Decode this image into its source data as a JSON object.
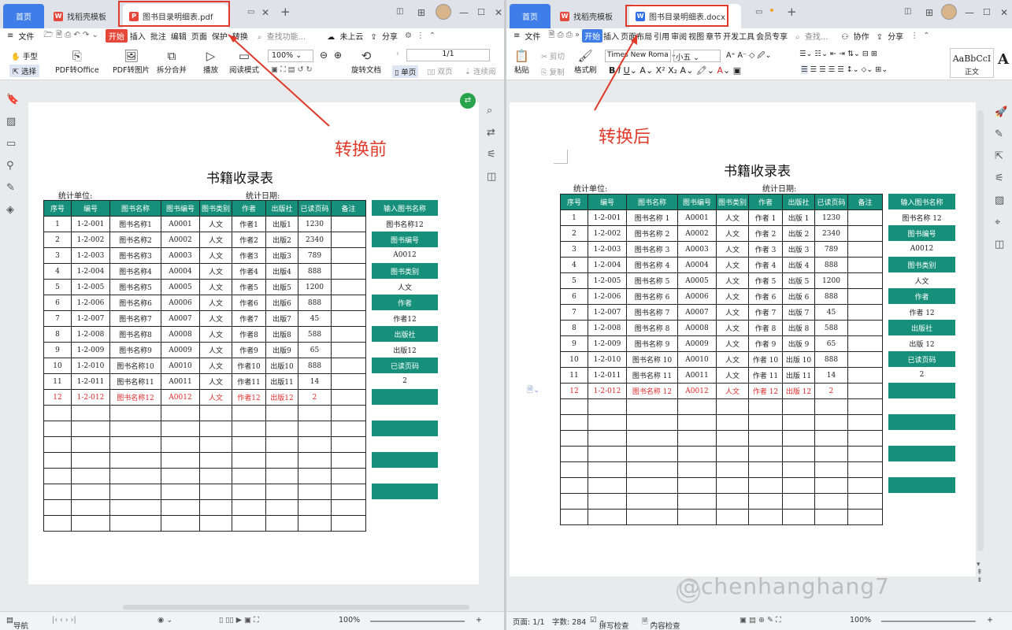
{
  "left": {
    "tabs": {
      "home": "首页",
      "template": "找稻壳模板",
      "active": "图书目录明细表.pdf"
    },
    "menu": [
      "文件",
      "开始",
      "插入",
      "批注",
      "编辑",
      "页面",
      "保护",
      "转换"
    ],
    "search": "查找功能...",
    "ribbon": {
      "hand": "手型",
      "select": "选择",
      "pdf_office": "PDF转Office",
      "pdf_image": "PDF转图片",
      "split": "拆分合并",
      "play": "播放",
      "read": "阅读模式",
      "zoom": "100%",
      "rotate": "旋转文档",
      "page": "1/1",
      "single": "单页",
      "double": "双页",
      "continuous": "连续阅"
    },
    "annotation": "转换前",
    "status": {
      "nav": "导航",
      "zoom": "100%"
    }
  },
  "right": {
    "tabs": {
      "home": "首页",
      "template": "找稻壳模板",
      "active": "图书目录明细表.docx"
    },
    "menu": [
      "文件",
      "开始",
      "插入",
      "页面布局",
      "引用",
      "审阅",
      "视图",
      "章节",
      "开发工具",
      "会员专享"
    ],
    "search": "查找...",
    "collab": "协作",
    "share": "分享",
    "ribbon": {
      "paste": "粘贴",
      "cut": "剪切",
      "copy": "复制",
      "format_painter": "格式刷",
      "font": "Times New Roma",
      "size": "小五",
      "style_sample": "AaBbCcI",
      "style_name": "正文"
    },
    "annotation": "转换后",
    "status": {
      "page": "页面: 1/1",
      "words": "字数: 284",
      "spell": "拼写检查",
      "content": "内容检查",
      "zoom": "100%"
    }
  },
  "upload": "未上云",
  "share": "分享",
  "watermark": "@chenhanghang7",
  "doc": {
    "title": "书籍收录表",
    "unit_label": "统计单位:",
    "date_label": "统计日期:",
    "headers": [
      "序号",
      "编号",
      "图书名称",
      "图书编号",
      "图书类别",
      "作者",
      "出版社",
      "已读页码",
      "备注"
    ],
    "rows_pdf": [
      [
        "1",
        "1-2-001",
        "图书名称1",
        "A0001",
        "人文",
        "作者1",
        "出版1",
        "1230",
        ""
      ],
      [
        "2",
        "1-2-002",
        "图书名称2",
        "A0002",
        "人文",
        "作者2",
        "出版2",
        "2340",
        ""
      ],
      [
        "3",
        "1-2-003",
        "图书名称3",
        "A0003",
        "人文",
        "作者3",
        "出版3",
        "789",
        ""
      ],
      [
        "4",
        "1-2-004",
        "图书名称4",
        "A0004",
        "人文",
        "作者4",
        "出版4",
        "888",
        ""
      ],
      [
        "5",
        "1-2-005",
        "图书名称5",
        "A0005",
        "人文",
        "作者5",
        "出版5",
        "1200",
        ""
      ],
      [
        "6",
        "1-2-006",
        "图书名称6",
        "A0006",
        "人文",
        "作者6",
        "出版6",
        "888",
        ""
      ],
      [
        "7",
        "1-2-007",
        "图书名称7",
        "A0007",
        "人文",
        "作者7",
        "出版7",
        "45",
        ""
      ],
      [
        "8",
        "1-2-008",
        "图书名称8",
        "A0008",
        "人文",
        "作者8",
        "出版8",
        "588",
        ""
      ],
      [
        "9",
        "1-2-009",
        "图书名称9",
        "A0009",
        "人文",
        "作者9",
        "出版9",
        "65",
        ""
      ],
      [
        "10",
        "1-2-010",
        "图书名称10",
        "A0010",
        "人文",
        "作者10",
        "出版10",
        "888",
        ""
      ],
      [
        "11",
        "1-2-011",
        "图书名称11",
        "A0011",
        "人文",
        "作者11",
        "出版11",
        "14",
        ""
      ],
      [
        "12",
        "1-2-012",
        "图书名称12",
        "A0012",
        "人文",
        "作者12",
        "出版12",
        "2",
        ""
      ]
    ],
    "rows_docx": [
      [
        "1",
        "1-2-001",
        "图书名称 1",
        "A0001",
        "人文",
        "作者 1",
        "出版 1",
        "1230",
        ""
      ],
      [
        "2",
        "1-2-002",
        "图书名称 2",
        "A0002",
        "人文",
        "作者 2",
        "出版 2",
        "2340",
        ""
      ],
      [
        "3",
        "1-2-003",
        "图书名称 3",
        "A0003",
        "人文",
        "作者 3",
        "出版 3",
        "789",
        ""
      ],
      [
        "4",
        "1-2-004",
        "图书名称 4",
        "A0004",
        "人文",
        "作者 4",
        "出版 4",
        "888",
        ""
      ],
      [
        "5",
        "1-2-005",
        "图书名称 5",
        "A0005",
        "人文",
        "作者 5",
        "出版 5",
        "1200",
        ""
      ],
      [
        "6",
        "1-2-006",
        "图书名称 6",
        "A0006",
        "人文",
        "作者 6",
        "出版 6",
        "888",
        ""
      ],
      [
        "7",
        "1-2-007",
        "图书名称 7",
        "A0007",
        "人文",
        "作者 7",
        "出版 7",
        "45",
        ""
      ],
      [
        "8",
        "1-2-008",
        "图书名称 8",
        "A0008",
        "人文",
        "作者 8",
        "出版 8",
        "588",
        ""
      ],
      [
        "9",
        "1-2-009",
        "图书名称 9",
        "A0009",
        "人文",
        "作者 9",
        "出版 9",
        "65",
        ""
      ],
      [
        "10",
        "1-2-010",
        "图书名称 10",
        "A0010",
        "人文",
        "作者 10",
        "出版 10",
        "888",
        ""
      ],
      [
        "11",
        "1-2-011",
        "图书名称 11",
        "A0011",
        "人文",
        "作者 11",
        "出版 11",
        "14",
        ""
      ],
      [
        "12",
        "1-2-012",
        "图书名称 12",
        "A0012",
        "人文",
        "作者 12",
        "出版 12",
        "2",
        ""
      ]
    ],
    "panel_pdf": [
      "输入图书名称",
      "图书名称12",
      "图书编号",
      "A0012",
      "图书类别",
      "人文",
      "作者",
      "作者12",
      "出版社",
      "出版12",
      "已读页码",
      "2"
    ],
    "panel_docx": [
      "输入图书名称",
      "图书名称 12",
      "图书编号",
      "A0012",
      "图书类别",
      "人文",
      "作者",
      "作者 12",
      "出版社",
      "出版 12",
      "已读页码",
      "2"
    ]
  }
}
